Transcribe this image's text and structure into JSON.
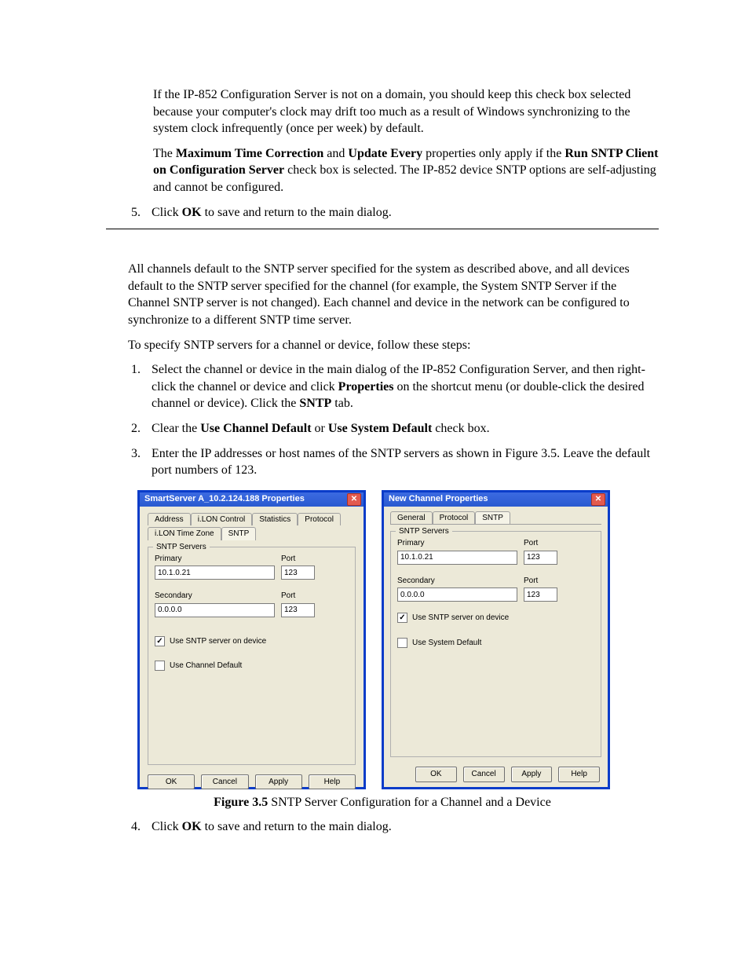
{
  "intro": {
    "p1a": "If the IP-852 Configuration Server is not on a domain, you should keep this check box selected because your computer's clock may drift too much as a result of Windows synchronizing to the system clock infrequently (once per week) by default.",
    "p2_prefix": "The ",
    "p2_b1": "Maximum Time Correction",
    "p2_mid1": " and ",
    "p2_b2": "Update Every",
    "p2_mid2": " properties only apply if the ",
    "p2_b3": "Run SNTP Client on Configuration Server",
    "p2_suffix": " check box is selected.  The IP-852 device SNTP options are self-adjusting and cannot be configured.",
    "s5_prefix": "Click ",
    "s5_b": "OK",
    "s5_suffix": " to save and return to the main dialog."
  },
  "body": {
    "p1": "All channels default to the SNTP server specified for the system as described above, and all devices default to the SNTP server specified for the channel (for example, the System SNTP Server if the Channel SNTP server is not changed).  Each channel and device in the network can be configured to synchronize to a different SNTP time server.",
    "p2": "To specify SNTP servers for a channel or device, follow these steps:"
  },
  "steps": {
    "s1_a": "Select the channel or device in the main dialog of the IP-852 Configuration Server, and then right-click the channel or device and click ",
    "s1_b1": "Properties",
    "s1_c": " on the shortcut menu (or double-click the desired channel or device).  Click the ",
    "s1_b2": "SNTP",
    "s1_d": " tab.",
    "s2_a": "Clear the ",
    "s2_b1": "Use Channel Default",
    "s2_c": " or ",
    "s2_b2": "Use System Default",
    "s2_d": " check box.",
    "s3": "Enter the IP addresses or host names of the SNTP servers as shown in Figure 3.5.  Leave the default port numbers of 123.",
    "s4_a": "Click ",
    "s4_b": "OK",
    "s4_c": " to save and return to the main dialog."
  },
  "caption": {
    "bold": "Figure 3.5",
    "rest": " SNTP Server Configuration for a Channel and a Device"
  },
  "dialog1": {
    "title": "SmartServer A_10.2.124.188 Properties",
    "tabs": [
      "Address",
      "i.LON Control",
      "Statistics",
      "Protocol",
      "i.LON Time Zone",
      "SNTP"
    ],
    "group_title": "SNTP Servers",
    "primary_label": "Primary",
    "port_label": "Port",
    "secondary_label": "Secondary",
    "primary_value": "10.1.0.21",
    "primary_port": "123",
    "secondary_value": "0.0.0.0",
    "secondary_port": "123",
    "chk1": "Use SNTP server on device",
    "chk2": "Use Channel Default",
    "buttons": [
      "OK",
      "Cancel",
      "Apply",
      "Help"
    ]
  },
  "dialog2": {
    "title": "New Channel Properties",
    "tabs": [
      "General",
      "Protocol",
      "SNTP"
    ],
    "group_title": "SNTP Servers",
    "primary_label": "Primary",
    "port_label": "Port",
    "secondary_label": "Secondary",
    "primary_value": "10.1.0.21",
    "primary_port": "123",
    "secondary_value": "0.0.0.0",
    "secondary_port": "123",
    "chk1": "Use SNTP server on device",
    "chk2": "Use System Default",
    "buttons": [
      "OK",
      "Cancel",
      "Apply",
      "Help"
    ]
  }
}
